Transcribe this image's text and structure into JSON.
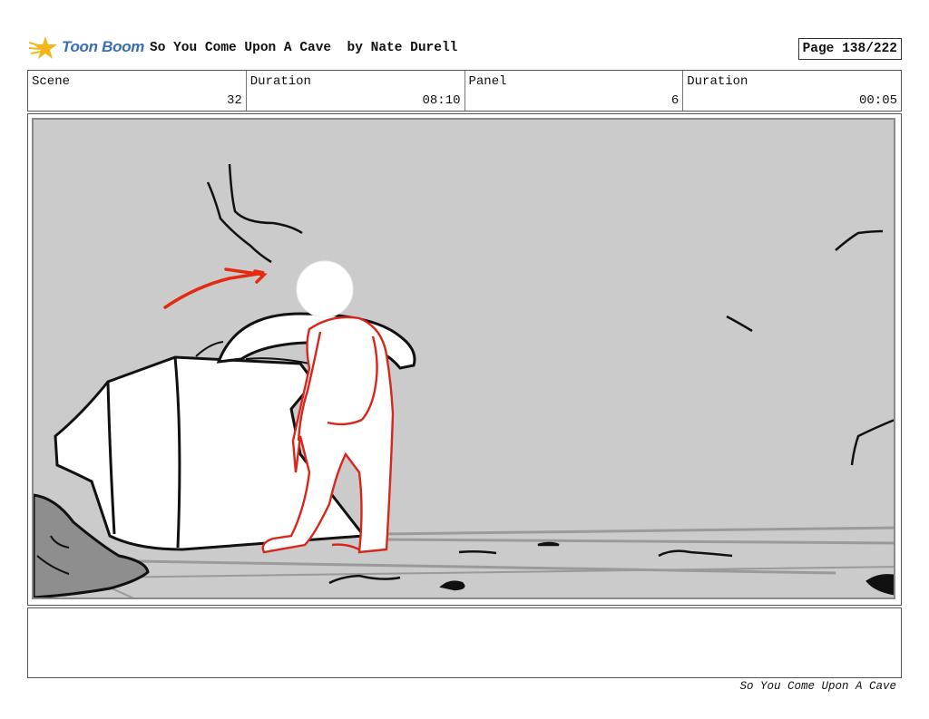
{
  "header": {
    "logo_text": "Toon Boom",
    "title": "So You Come Upon A Cave  by Nate Durell",
    "page": "Page 138/222"
  },
  "info": {
    "scene_label": "Scene",
    "scene_value": "32",
    "scene_duration_label": "Duration",
    "scene_duration_value": "08:10",
    "panel_label": "Panel",
    "panel_value": "6",
    "panel_duration_label": "Duration",
    "panel_duration_value": "00:05"
  },
  "footer": {
    "text": "So You Come Upon A Cave"
  },
  "colors": {
    "panel_background": "#cbcbcb",
    "sketch_red": "#d8261c",
    "logo_blue": "#3a6db8",
    "logo_star": "#f4b619"
  }
}
